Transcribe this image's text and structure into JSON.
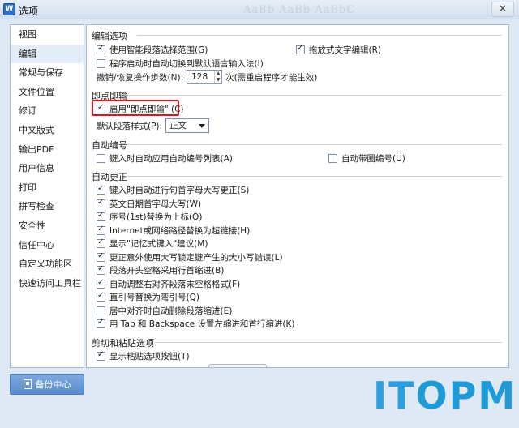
{
  "window": {
    "title": "选项",
    "ghost_text": "AaBb AaBb AaBbC"
  },
  "sidebar": {
    "items": [
      {
        "label": "视图"
      },
      {
        "label": "编辑"
      },
      {
        "label": "常规与保存"
      },
      {
        "label": "文件位置"
      },
      {
        "label": "修订"
      },
      {
        "label": "中文版式"
      },
      {
        "label": "输出PDF"
      },
      {
        "label": "用户信息"
      },
      {
        "label": "打印"
      },
      {
        "label": "拼写检查"
      },
      {
        "label": "安全性"
      },
      {
        "label": "信任中心"
      },
      {
        "label": "自定义功能区"
      },
      {
        "label": "快速访问工具栏"
      }
    ],
    "active_index": 1
  },
  "sections": {
    "edit": {
      "title": "编辑选项",
      "smart_select": {
        "label": "使用智能段落选择范围(G)",
        "checked": true
      },
      "drag_text": {
        "label": "拖放式文字编辑(R)",
        "checked": true
      },
      "auto_ime": {
        "label": "程序启动时自动切换到默认语言输入法(I)",
        "checked": false
      },
      "undo_label": "撤销/恢复操作步数(N):",
      "undo_value": "128",
      "undo_note": "次(需重启程序才能生效)"
    },
    "click_type": {
      "title": "即点即输",
      "enable": {
        "label": "启用\"即点即输\" (C)",
        "checked": true
      },
      "style_label": "默认段落样式(P):",
      "style_value": "正文"
    },
    "auto_number": {
      "title": "自动编号",
      "auto_list": {
        "label": "键入时自动应用自动编号列表(A)",
        "checked": false
      },
      "circle_num": {
        "label": "自动带圈编号(U)",
        "checked": false
      }
    },
    "auto_correct": {
      "title": "自动更正",
      "items": [
        {
          "label": "键入时自动进行句首字母大写更正(S)",
          "checked": true
        },
        {
          "label": "英文日期首字母大写(W)",
          "checked": true
        },
        {
          "label": "序号(1st)替换为上标(O)",
          "checked": true
        },
        {
          "label": "Internet或网络路径替换为超链接(H)",
          "checked": true
        },
        {
          "label": "显示\"记忆式键入\"建议(M)",
          "checked": true
        },
        {
          "label": "更正意外使用大写锁定键产生的大小写错误(L)",
          "checked": true
        },
        {
          "label": "段落开头空格采用行首缩进(B)",
          "checked": true
        },
        {
          "label": "自动调整右对齐段落末空格格式(F)",
          "checked": true
        },
        {
          "label": "直引号替换为弯引号(Q)",
          "checked": true
        },
        {
          "label": "居中对齐时自动删除段落缩进(E)",
          "checked": false
        },
        {
          "label": "用 Tab 和 Backspace 设置左缩进和首行缩进(K)",
          "checked": true
        }
      ]
    },
    "paste": {
      "title": "剪切和粘贴选项",
      "show_button": {
        "label": "显示粘贴选项按钮(T)",
        "checked": true
      }
    }
  },
  "backup_button": {
    "label": "备份中心"
  },
  "logo": {
    "part1": "IT",
    "part2": "OPM"
  },
  "colors": {
    "highlight": "#e0141c",
    "accent": "#5a8bcc",
    "logo": "#1e9ad6"
  }
}
